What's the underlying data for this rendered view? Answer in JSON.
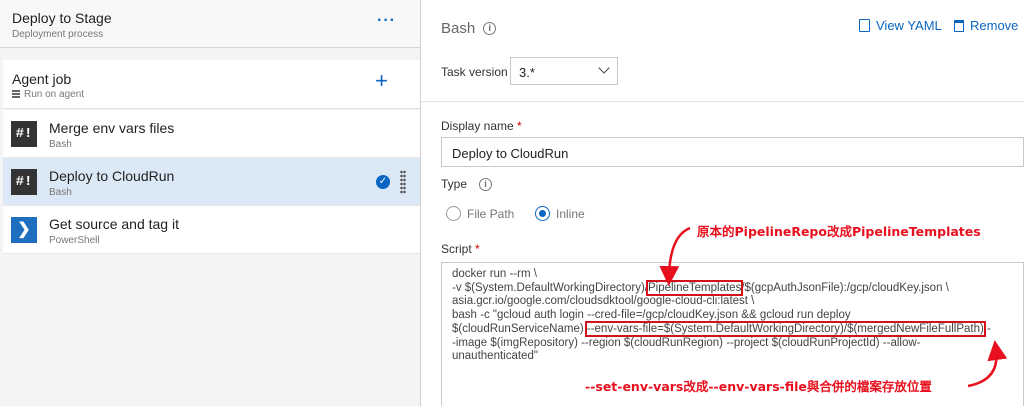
{
  "stage": {
    "title": "Deploy to Stage",
    "subtitle": "Deployment process",
    "more": "···"
  },
  "job": {
    "title": "Agent job",
    "subtitle": "Run on agent",
    "add": "+"
  },
  "tasks": [
    {
      "name": "Merge env vars files",
      "sub": "Bash",
      "icon": "#!"
    },
    {
      "name": "Deploy to CloudRun",
      "sub": "Bash",
      "icon": "#!"
    },
    {
      "name": "Get source and tag it",
      "sub": "PowerShell",
      "icon": "❯"
    }
  ],
  "panel": {
    "title": "Bash",
    "view_yaml": "View YAML",
    "remove": "Remove",
    "task_version_label": "Task version",
    "task_version_value": "3.*",
    "display_name_label": "Display name",
    "display_name_value": "Deploy to CloudRun",
    "type_label": "Type",
    "type_options": [
      "File Path",
      "Inline"
    ],
    "script_label": "Script",
    "required": "*"
  },
  "script": {
    "line1": "docker run --rm \\",
    "line2a": "-v $(System.DefaultWorkingDirectory)/",
    "line2b": "PipelineTemplates",
    "line2c": "/$(gcpAuthJsonFile):/gcp/cloudKey.json \\",
    "line3": "asia.gcr.io/google.com/cloudsdktool/google-cloud-cli:latest \\",
    "line4": "bash -c \"gcloud auth login --cred-file=/gcp/cloudKey.json && gcloud run deploy",
    "line5a": "$(cloudRunServiceName) ",
    "line5b": "--env-vars-file=$(System.DefaultWorkingDirectory)/$(mergedNewFileFullPath)",
    "line5c": " -",
    "line6": "-image $(imgRepository) --region $(cloudRunRegion) --project $(cloudRunProjectId) --allow-",
    "line7": "unauthenticated\""
  },
  "annotations": {
    "top": "原本的PipelineRepo改成PipelineTemplates",
    "bottom": "--set-env-vars改成--env-vars-file與合併的檔案存放位置"
  },
  "colors": {
    "accent": "#0a66c2",
    "annotation": "#e8101e",
    "selected": "#dbe8f5"
  }
}
